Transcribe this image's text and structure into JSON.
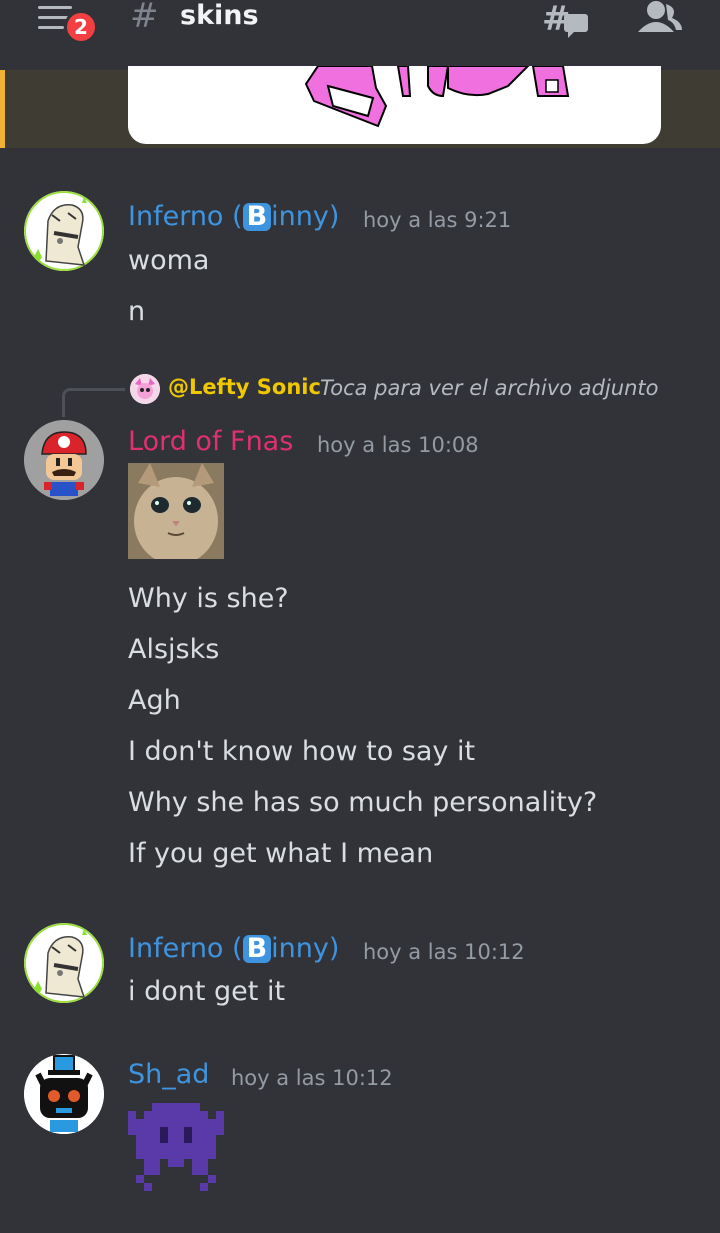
{
  "header": {
    "menu_badge_count": "2",
    "channel_hash": "#",
    "channel_name": "skins"
  },
  "colors": {
    "background": "#313338",
    "username_inferno": "#3f94e0",
    "username_lord": "#e0306e",
    "username_shad": "#3f94e0",
    "reply_username": "#f0c800",
    "highlight_border": "#f0b232",
    "badge": "#f23f43"
  },
  "messages": [
    {
      "username_pre": "Inferno (",
      "username_badge": "B",
      "username_post": "inny)",
      "timestamp": "hoy a las 9:21",
      "lines": [
        "woma",
        "n"
      ]
    },
    {
      "reply": {
        "username": "@Lefty Sonic",
        "preview": "Toca para ver el archivo adjunto"
      },
      "username": "Lord of Fnas",
      "timestamp": "hoy a las 10:08",
      "lines": [
        "Why is she?",
        "Alsjsks",
        "Agh",
        "I don't know how to say it",
        "Why she has so much personality?",
        "If you get what I mean"
      ]
    },
    {
      "username_pre": "Inferno (",
      "username_badge": "B",
      "username_post": "inny)",
      "timestamp": "hoy a las 10:12",
      "lines": [
        "i dont get it"
      ]
    },
    {
      "username": "Sh_ad",
      "timestamp": "hoy a las 10:12"
    }
  ]
}
